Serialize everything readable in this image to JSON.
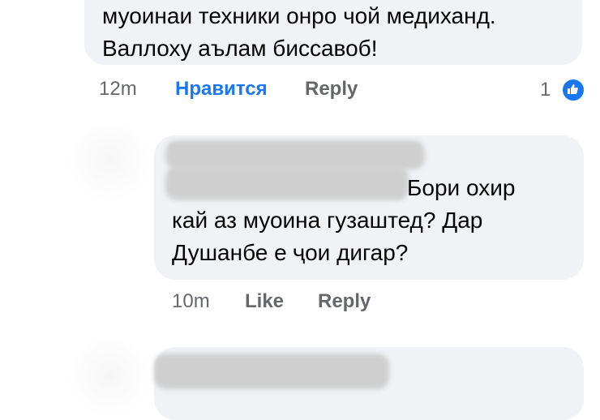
{
  "comments": [
    {
      "lines": [
        "муоинаи техники онро чой медиханд.",
        "Валлоху аълам биссавоб!"
      ],
      "time": "12m",
      "like_label": "Нравится",
      "reply_label": "Reply",
      "reaction_count": "1",
      "reaction_icon": "thumbs-up-icon",
      "liked": true
    },
    {
      "lines": [
        "Бори охир",
        "кай аз муоина гузаштед? Дар",
        "Душанбе е ҷои дигар?"
      ],
      "time": "10m",
      "like_label": "Like",
      "reply_label": "Reply",
      "liked": false
    }
  ],
  "colors": {
    "bubble": "#f0f2f5",
    "accent": "#1877f2",
    "meta": "#65676b"
  }
}
